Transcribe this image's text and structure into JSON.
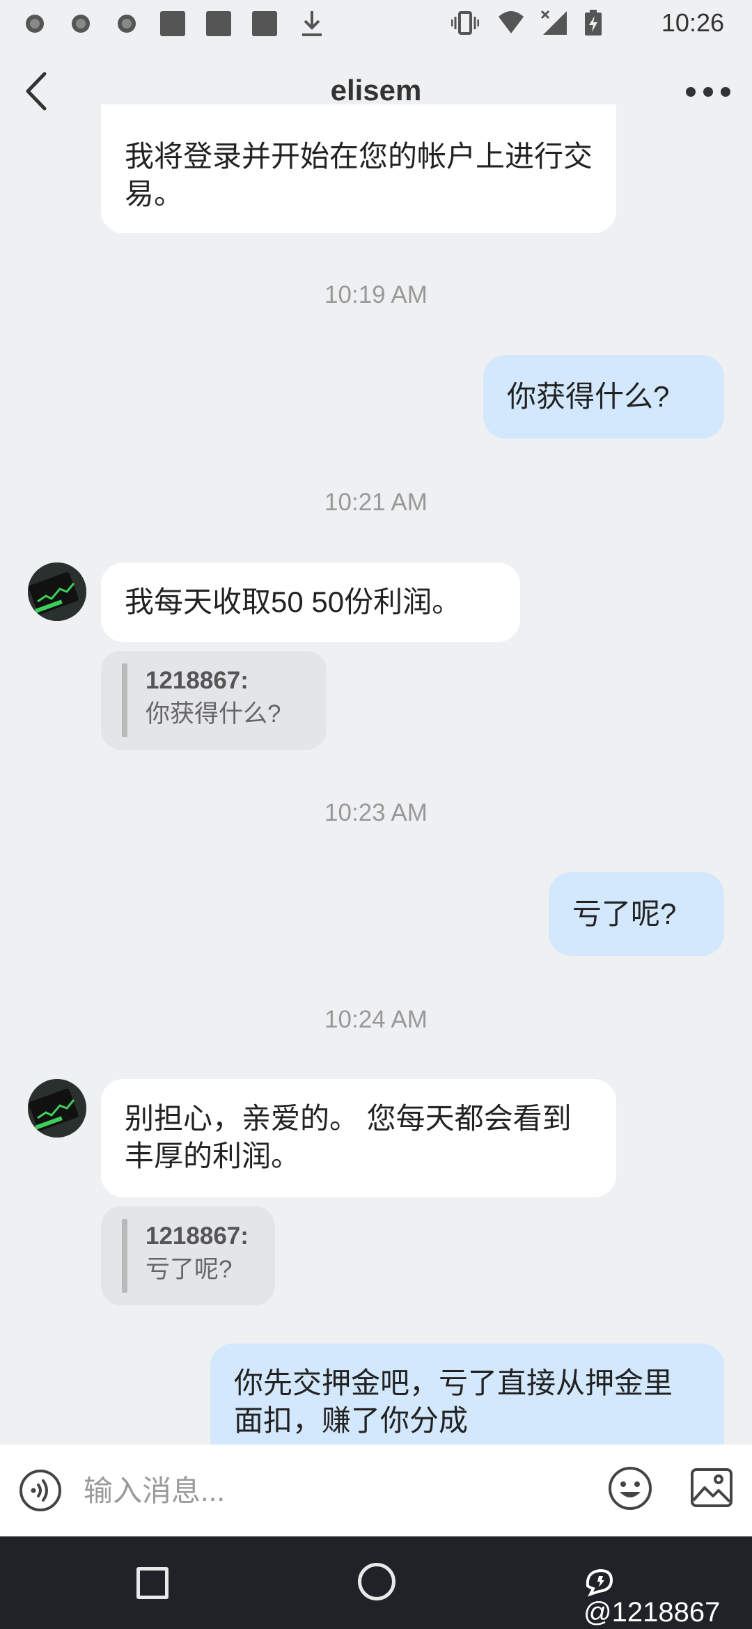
{
  "status_bar": {
    "time": "10:26",
    "icons": [
      "notification-icon",
      "notification-icon",
      "notification-icon",
      "app-icon",
      "app-icon",
      "app-icon",
      "download-icon",
      "vibrate-icon",
      "wifi-icon",
      "signal-icon",
      "battery-icon"
    ]
  },
  "header": {
    "title": "elisem"
  },
  "messages": [
    {
      "type": "incoming",
      "text": "我将登录并开始在您的帐户上进行交易。"
    },
    {
      "type": "timestamp",
      "text": "10:19 AM"
    },
    {
      "type": "outgoing",
      "text": "你获得什么?"
    },
    {
      "type": "timestamp",
      "text": "10:21 AM"
    },
    {
      "type": "incoming",
      "text": "我每天收取50 50份利润。",
      "quote": {
        "name": "1218867:",
        "text": "你获得什么?"
      }
    },
    {
      "type": "timestamp",
      "text": "10:23 AM"
    },
    {
      "type": "outgoing",
      "text": "亏了呢?"
    },
    {
      "type": "timestamp",
      "text": "10:24 AM"
    },
    {
      "type": "incoming",
      "text": "别担心，亲爱的。 您每天都会看到丰厚的利润。",
      "quote": {
        "name": "1218867:",
        "text": "亏了呢?"
      }
    },
    {
      "type": "outgoing",
      "text": "你先交押金吧，亏了直接从押金里面扣，赚了你分成"
    }
  ],
  "input": {
    "placeholder": "输入消息..."
  },
  "watermark": "@1218867",
  "colors": {
    "background": "#eff0f2",
    "incoming_bubble": "#ffffff",
    "outgoing_bubble": "#d3e8fc",
    "nav_bar": "#1f2226"
  }
}
